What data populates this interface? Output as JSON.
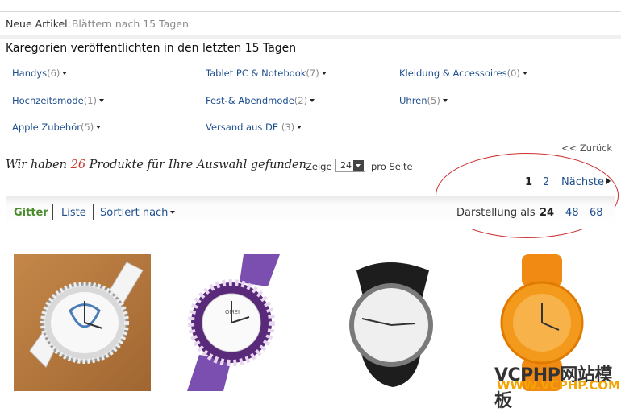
{
  "header": {
    "new_label": "Neue Artikel:",
    "browse": "Blättern nach 15 Tagen",
    "title": "Karegorien veröffentlichten in den letzten 15 Tagen"
  },
  "categories": [
    {
      "name": "Handys",
      "count": "(6)"
    },
    {
      "name": "Tablet PC & Notebook",
      "count": "(7)"
    },
    {
      "name": "Kleidung & Accessoires",
      "count": "(0)"
    },
    {
      "name": "Hochzeitsmode",
      "count": "(1)"
    },
    {
      "name": "Fest-& Abendmode",
      "count": "(2)"
    },
    {
      "name": "Uhren",
      "count": "(5)"
    },
    {
      "name": "Apple Zubehör",
      "count": "(5)"
    },
    {
      "name": "Versand aus DE",
      "count": " (3)"
    }
  ],
  "back": "<< Zurück",
  "results": {
    "prefix": "Wir haben ",
    "count": "26",
    "suffix": " Produkte für Ihre Auswahl gefunden.",
    "show": "Zeige",
    "per_page_value": "24",
    "per_page": "pro Seite"
  },
  "pager": {
    "current": "1",
    "page2": "2",
    "next": "Nächste"
  },
  "toolbar": {
    "grid": "Gitter",
    "list": "Liste",
    "sort": "Sortiert nach",
    "display": "Darstellung als",
    "opt1": "24",
    "opt2": "48",
    "opt3": "68"
  },
  "colors": {
    "link": "#1f4f8f",
    "active": "#4a8c2a",
    "accent_red": "#c0392b",
    "watermark": "#f4a300"
  },
  "watermark": {
    "line1": "VCPHP网站模板",
    "line2": "WWW.VCPHP.COM"
  }
}
